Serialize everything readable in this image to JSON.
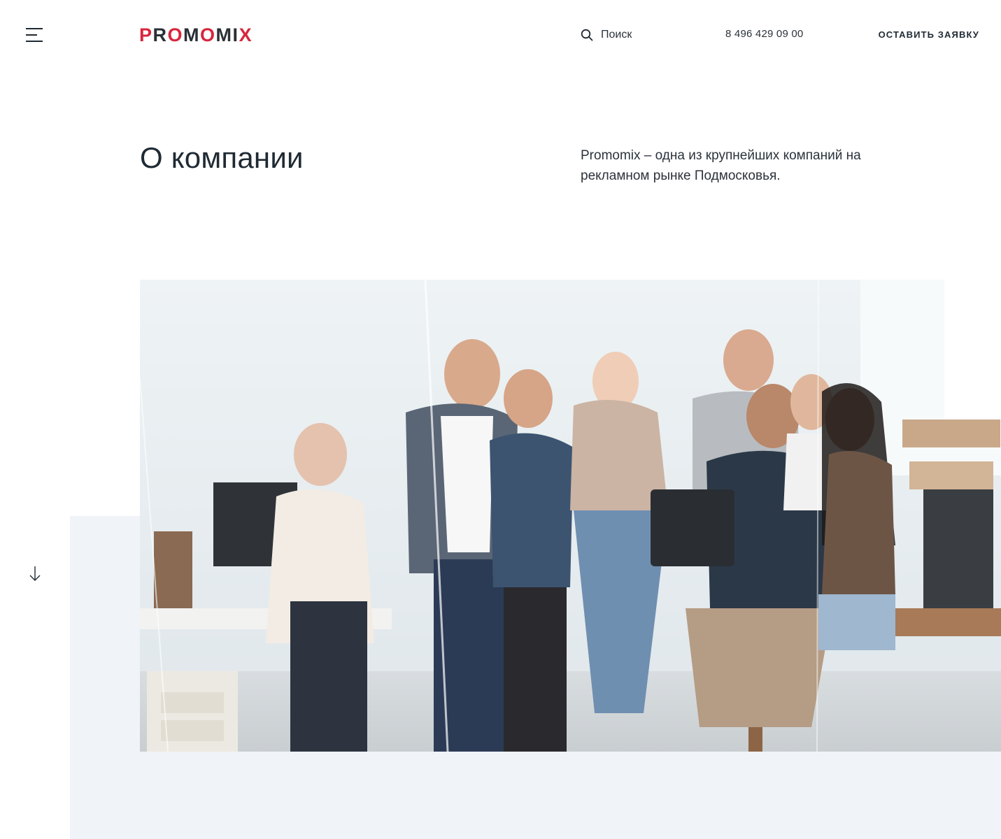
{
  "header": {
    "logo_text": "PROMOMIX",
    "search_label": "Поиск",
    "phone": "8 496 429 09 00",
    "cta_label": "ОСТАВИТЬ ЗАЯВКУ"
  },
  "intro": {
    "title": "О компании",
    "lead": "Promomix – одна из крупнейших компаний на рекламном рынке Подмосковья."
  },
  "icons": {
    "menu": "menu-icon",
    "search": "search-icon",
    "scroll": "arrow-down-icon"
  },
  "colors": {
    "brand_red": "#d7263d",
    "text_dark": "#1f2a33",
    "block_bg": "#f0f3f7"
  }
}
